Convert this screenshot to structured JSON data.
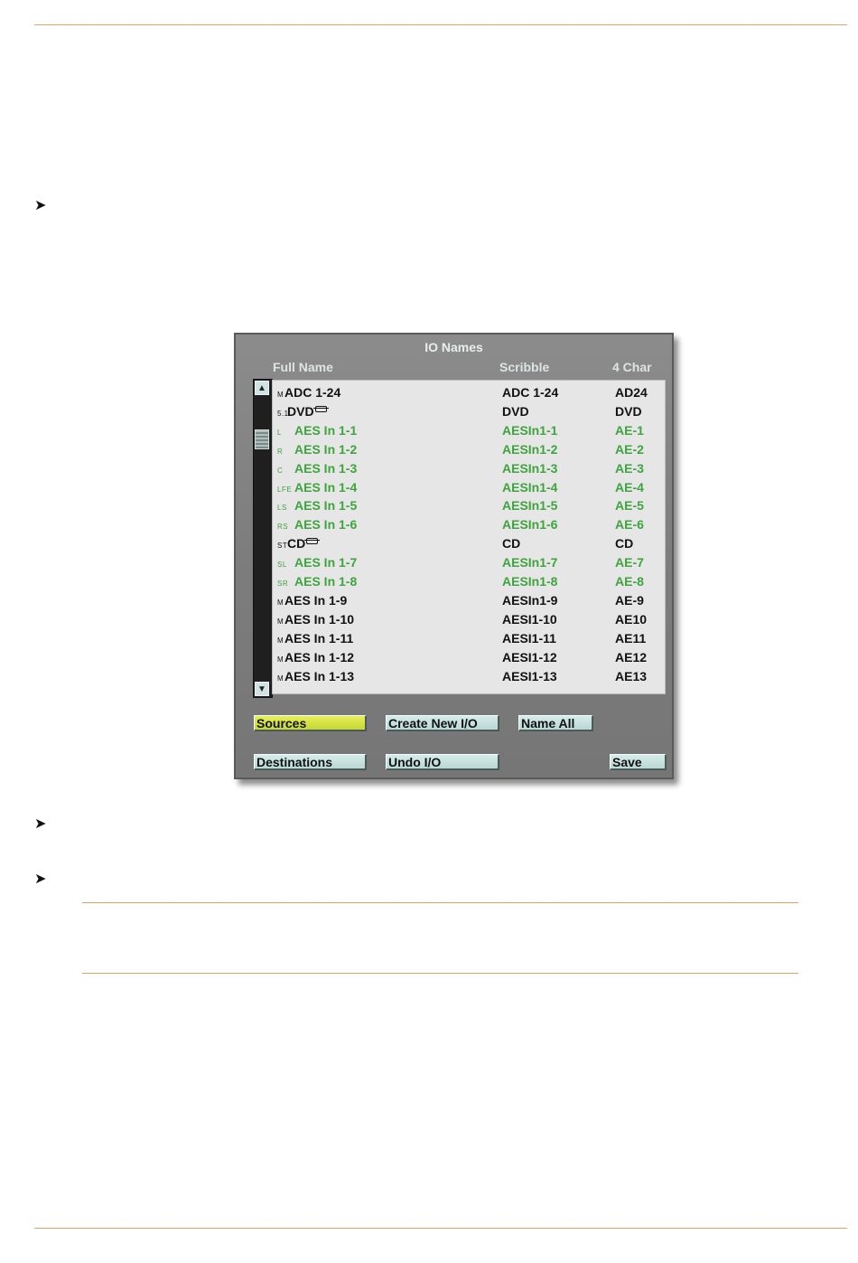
{
  "panel": {
    "title": "IO Names",
    "headers": {
      "full_name": "Full Name",
      "scribble": "Scribble",
      "four_char": "4 Char"
    },
    "rows": [
      {
        "fmt": "M",
        "name": "ADC 1-24",
        "link": false,
        "scribble": "ADC 1-24",
        "four": "AD24",
        "color": "black"
      },
      {
        "fmt": "5.1",
        "name": "DVD",
        "link": true,
        "scribble": "DVD",
        "four": "DVD",
        "color": "black"
      },
      {
        "fmt": "L",
        "name": "AES In 1-1",
        "link": false,
        "scribble": "AESIn1-1",
        "four": "AE-1",
        "color": "green"
      },
      {
        "fmt": "R",
        "name": "AES In 1-2",
        "link": false,
        "scribble": "AESIn1-2",
        "four": "AE-2",
        "color": "green"
      },
      {
        "fmt": "C",
        "name": "AES In 1-3",
        "link": false,
        "scribble": "AESIn1-3",
        "four": "AE-3",
        "color": "green"
      },
      {
        "fmt": "LFE",
        "name": "AES In 1-4",
        "link": false,
        "scribble": "AESIn1-4",
        "four": "AE-4",
        "color": "green"
      },
      {
        "fmt": "LS",
        "name": "AES In 1-5",
        "link": false,
        "scribble": "AESIn1-5",
        "four": "AE-5",
        "color": "green"
      },
      {
        "fmt": "RS",
        "name": "AES In 1-6",
        "link": false,
        "scribble": "AESIn1-6",
        "four": "AE-6",
        "color": "green"
      },
      {
        "fmt": "ST",
        "name": "CD",
        "link": true,
        "scribble": "CD",
        "four": "CD",
        "color": "black"
      },
      {
        "fmt": "SL",
        "name": "AES In 1-7",
        "link": false,
        "scribble": "AESIn1-7",
        "four": "AE-7",
        "color": "green"
      },
      {
        "fmt": "SR",
        "name": "AES In 1-8",
        "link": false,
        "scribble": "AESIn1-8",
        "four": "AE-8",
        "color": "green"
      },
      {
        "fmt": "M",
        "name": "AES In 1-9",
        "link": false,
        "scribble": "AESIn1-9",
        "four": "AE-9",
        "color": "black"
      },
      {
        "fmt": "M",
        "name": "AES In 1-10",
        "link": false,
        "scribble": "AESI1-10",
        "four": "AE10",
        "color": "black"
      },
      {
        "fmt": "M",
        "name": "AES In 1-11",
        "link": false,
        "scribble": "AESI1-11",
        "four": "AE11",
        "color": "black"
      },
      {
        "fmt": "M",
        "name": "AES In 1-12",
        "link": false,
        "scribble": "AESI1-12",
        "four": "AE12",
        "color": "black"
      },
      {
        "fmt": "M",
        "name": "AES In 1-13",
        "link": false,
        "scribble": "AESI1-13",
        "four": "AE13",
        "color": "black"
      }
    ],
    "buttons": {
      "sources": "Sources",
      "create_new": "Create New I/O",
      "name_all": "Name All",
      "destinations": "Destinations",
      "undo": "Undo I/O",
      "save": "Save"
    },
    "scroll_up_icon": "triangle-up-icon",
    "scroll_down_icon": "triangle-down-icon"
  },
  "bullets": {
    "glyph": "➤"
  },
  "colors": {
    "rule": "#d9a468",
    "green_text": "#3ea43e",
    "sources_active": "#d8e446",
    "button_face": "#c8e1de"
  }
}
